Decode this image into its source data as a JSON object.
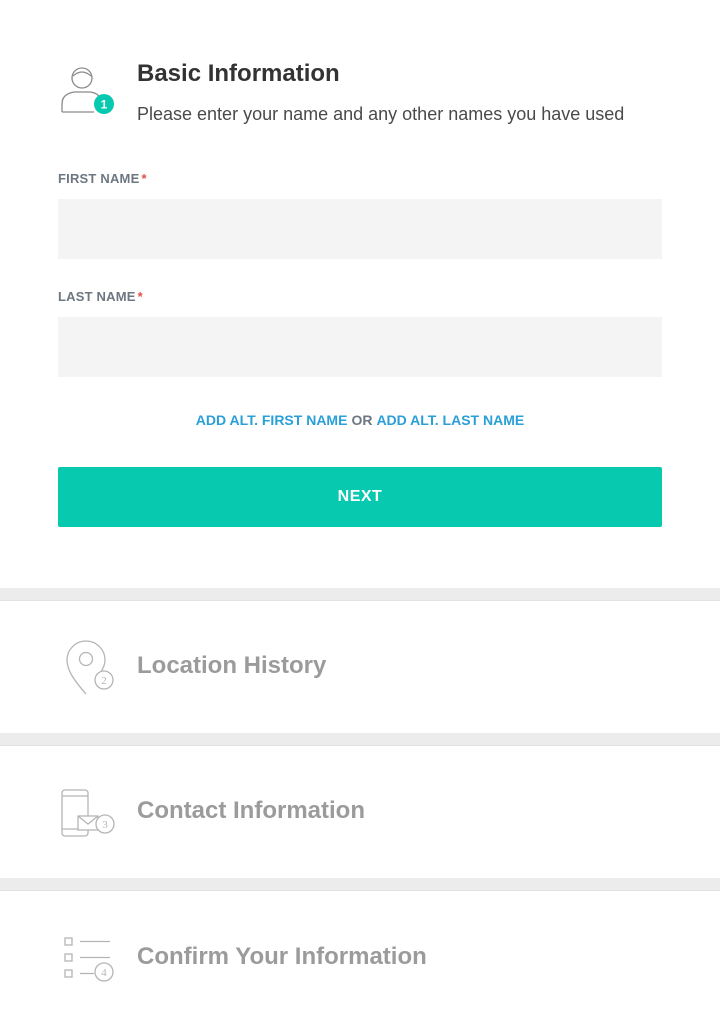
{
  "steps": [
    {
      "number": "1",
      "title": "Basic Information",
      "subtitle": "Please enter your name and any other names you have used",
      "icon": "person-icon",
      "active": true
    },
    {
      "number": "2",
      "title": "Location History",
      "icon": "location-pin-icon",
      "active": false
    },
    {
      "number": "3",
      "title": "Contact Information",
      "icon": "phone-mail-icon",
      "active": false
    },
    {
      "number": "4",
      "title": "Confirm Your Information",
      "icon": "checklist-icon",
      "active": false
    }
  ],
  "form": {
    "first_name": {
      "label": "FIRST NAME",
      "required_marker": "*",
      "value": "",
      "placeholder": ""
    },
    "last_name": {
      "label": "LAST NAME",
      "required_marker": "*",
      "value": "",
      "placeholder": ""
    },
    "alt_links": {
      "alt_first": "ADD ALT. FIRST NAME",
      "or": "OR",
      "alt_last": "ADD ALT. LAST NAME"
    },
    "next_label": "NEXT"
  },
  "colors": {
    "accent": "#06c9b0",
    "link": "#2a9fd8",
    "required": "#e0514a",
    "input_bg": "#f4f4f4",
    "muted_text": "#9b9b9b"
  }
}
